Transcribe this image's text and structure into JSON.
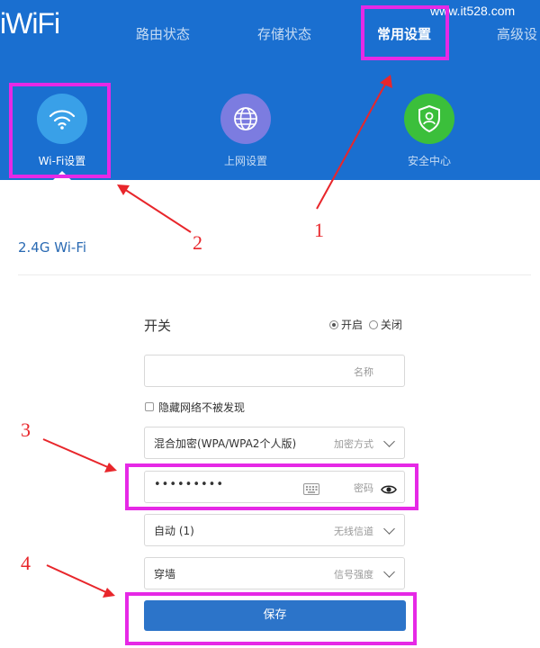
{
  "header": {
    "logo": "iWiFi",
    "watermark": "www.it528.com",
    "nav": [
      {
        "label": "路由状态"
      },
      {
        "label": "存储状态"
      },
      {
        "label": "常用设置"
      },
      {
        "label": "高级设"
      }
    ],
    "active_nav": "常用设置",
    "subnav": [
      {
        "label": "Wi-Fi设置",
        "icon": "wifi-icon",
        "color": "#39a0e8"
      },
      {
        "label": "上网设置",
        "icon": "globe-icon",
        "color": "#7c7ce0"
      },
      {
        "label": "安全中心",
        "icon": "shield-icon",
        "color": "#3bbf3b"
      }
    ]
  },
  "annotations": [
    "1",
    "2",
    "3",
    "4"
  ],
  "section": {
    "title": "2.4G Wi-Fi"
  },
  "form": {
    "switch_label": "开关",
    "on_label": "开启",
    "off_label": "关闭",
    "switch_value": "on",
    "name_placeholder": "名称",
    "name_value": "",
    "hide_network_label": "隐藏网络不被发现",
    "hide_network_checked": false,
    "encryption_value": "混合加密(WPA/WPA2个人版)",
    "encryption_placeholder": "加密方式",
    "password_value": "•••••••••",
    "password_placeholder": "密码",
    "channel_value": "自动 (1)",
    "channel_placeholder": "无线信道",
    "signal_value": "穿墙",
    "signal_placeholder": "信号强度",
    "save_label": "保存"
  },
  "colors": {
    "header_bg": "#1a6fd0",
    "annotation_box": "#e629e6",
    "annotation_text": "#e8262b",
    "save_button": "#2c74c9",
    "section_title": "#2a6ab3"
  }
}
